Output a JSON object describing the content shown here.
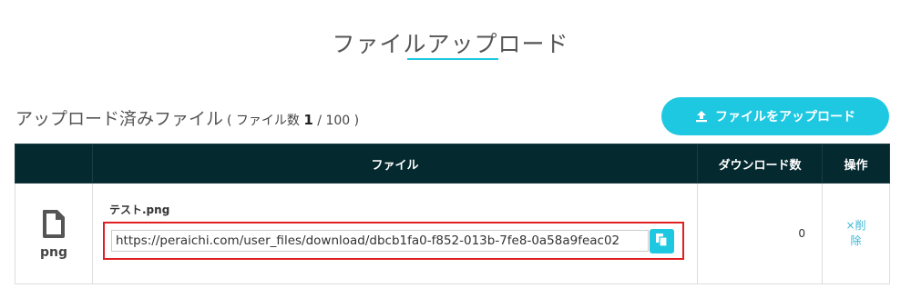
{
  "page": {
    "title": "ファイルアップロード"
  },
  "uploaded": {
    "heading": "アップロード済みファイル",
    "count_open": "( ファイル数 ",
    "count_current": "1",
    "count_sep": " / ",
    "count_max": "100",
    "count_close": " )",
    "upload_button_label": "ファイルをアップロード",
    "upload_icon": "upload-icon"
  },
  "table": {
    "headers": [
      "",
      "ファイル",
      "ダウンロード数",
      "操作"
    ],
    "rows": [
      {
        "type_icon": "file-icon",
        "type_label": "png",
        "file_name": "テスト.png",
        "url": "https://peraichi.com/user_files/download/dbcb1fa0-f852-013b-7fe8-0a58a9feac02",
        "copy_icon": "copy-icon",
        "downloads": "0",
        "delete_label": "×削除"
      }
    ]
  },
  "colors": {
    "accent": "#1ec8e1",
    "header_bg": "#04292f",
    "highlight_border": "#e02020",
    "link": "#3bb6d6"
  }
}
